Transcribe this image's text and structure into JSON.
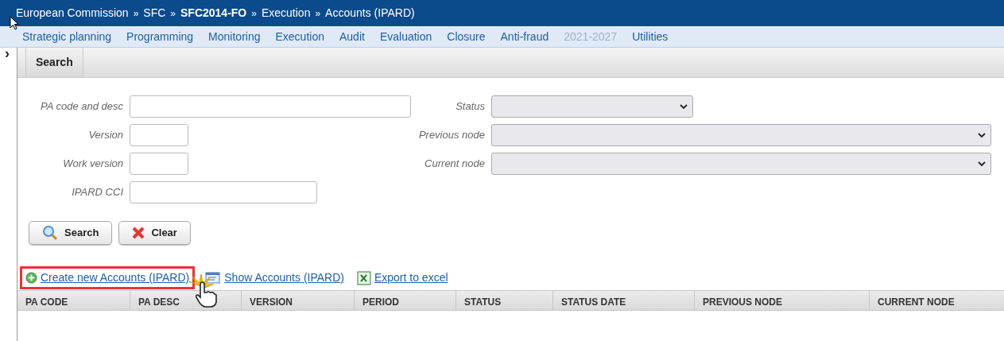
{
  "breadcrumb": [
    {
      "label": "European Commission",
      "bold": false
    },
    {
      "label": "SFC",
      "bold": false
    },
    {
      "label": "SFC2014-FO",
      "bold": true
    },
    {
      "label": "Execution",
      "bold": false
    },
    {
      "label": "Accounts (IPARD)",
      "bold": false
    }
  ],
  "breadcrumb_separator": "»",
  "menu": [
    {
      "label": "Strategic planning",
      "disabled": false
    },
    {
      "label": "Programming",
      "disabled": false
    },
    {
      "label": "Monitoring",
      "disabled": false
    },
    {
      "label": "Execution",
      "disabled": false
    },
    {
      "label": "Audit",
      "disabled": false
    },
    {
      "label": "Evaluation",
      "disabled": false
    },
    {
      "label": "Closure",
      "disabled": false
    },
    {
      "label": "Anti-fraud",
      "disabled": false
    },
    {
      "label": "2021-2027",
      "disabled": true
    },
    {
      "label": "Utilities",
      "disabled": false
    }
  ],
  "sidebar_toggle": "›",
  "panel_tabs": [
    {
      "label": "Search",
      "selected": true
    }
  ],
  "left_fields": [
    {
      "label": "PA code and desc"
    },
    {
      "label": "Version"
    },
    {
      "label": "Work version"
    },
    {
      "label": "IPARD CCI"
    }
  ],
  "right_fields": [
    {
      "label": "Status"
    },
    {
      "label": "Previous node"
    },
    {
      "label": "Current node"
    }
  ],
  "buttons": [
    {
      "label": "Search",
      "kind": "search"
    },
    {
      "label": "Clear",
      "kind": "clear"
    }
  ],
  "links": [
    {
      "label": "Create new Accounts (IPARD)",
      "kind": "create",
      "highlighted": true
    },
    {
      "label": "Show Accounts (IPARD)",
      "kind": "show",
      "highlighted": false
    },
    {
      "label": "Export to excel",
      "kind": "excel",
      "highlighted": false
    }
  ],
  "table": {
    "columns": [
      "PA CODE",
      "PA DESC",
      "VERSION",
      "PERIOD",
      "STATUS",
      "STATUS DATE",
      "PREVIOUS NODE",
      "CURRENT NODE"
    ]
  }
}
